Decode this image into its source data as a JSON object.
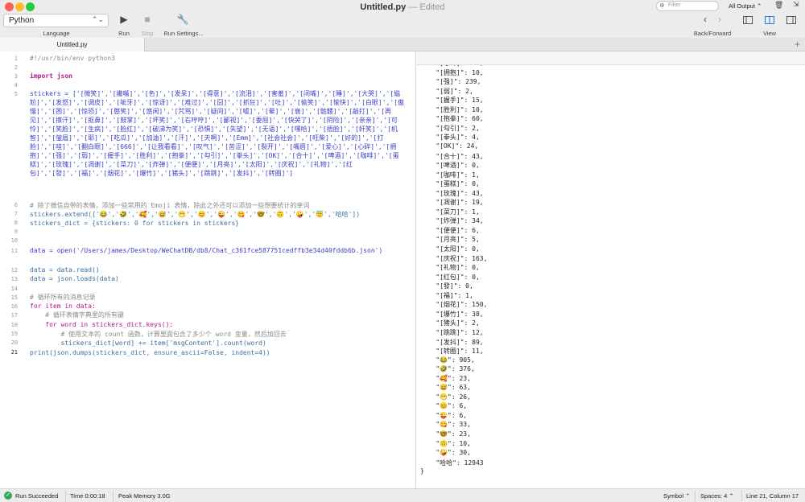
{
  "window": {
    "title": "Untitled.py",
    "edited": "— Edited",
    "colors": {
      "close": "#ff5f57",
      "minimize": "#febc2e",
      "zoom": "#28c840"
    }
  },
  "toolbar": {
    "language_value": "Python",
    "language_caption": "Language",
    "run_label": "Run",
    "stop_label": "Stop",
    "settings_label": "Run Settings...",
    "back_forward_label": "Back/Forward",
    "view_label": "View",
    "icons": {
      "run": "play-icon",
      "stop": "stop-icon",
      "settings": "wrench-icon",
      "back": "chevron-left-icon",
      "forward": "chevron-right-icon",
      "left_panel": "left-panel-icon",
      "split": "split-view-icon",
      "right_panel": "right-panel-icon"
    }
  },
  "tab": {
    "label": "Untitled.py",
    "add": "+"
  },
  "editor": {
    "line_numbers": [
      "1",
      "2",
      "3",
      "4",
      "5",
      "6",
      "7",
      "8",
      "9",
      "10",
      "11",
      "12",
      "13",
      "14",
      "15",
      "16",
      "17",
      "18",
      "19",
      "20",
      "21"
    ],
    "current_line": "21",
    "code": [
      "#!/usr/bin/env python3",
      "",
      "import json",
      "",
      "stickers = ['[微笑]','[撇嘴]','[色]','[发呆]','[得意]','[流泪]','[害羞]','[闭嘴]','[睡]','[大哭]','[尴尬]','[发怒]','[调皮]','[呲牙]','[惊讶]','[难过]','[囧]','[抓狂]','[吐]','[偷笑]','[愉快]','[白眼]','[傲慢]','[困]','[惊恐]','[憨笑]','[悠闲]','[咒骂]','[疑问]','[嘘]','[晕]','[衰]','[骷髅]','[敲打]','[再见]','[擦汗]','[抠鼻]','[鼓掌]','[坏笑]','[右哼哼]','[鄙视]','[委屈]','[快哭了]','[阴险]','[亲亲]','[可怜]','[笑脸]','[生病]','[脸红]','[破涕为笑]','[恐惧]','[失望]','[无语]','[嘿哈]','[捂脸]','[奸笑]','[机智]','[皱眉]','[耶]','[吃瓜]','[加油]','[汗]','[天啊]','[Emm]','[社会社会]','[旺柴]','[好的]','[打脸]','[哇]','[翻白眼]','[666]','[让我看看]','[叹气]','[苦涩]','[裂开]','[嘴唇]','[爱心]','[心碎]','[拥抱]','[强]','[弱]','[握手]','[胜利]','[抱拳]','[勾引]','[拳头]','[OK]','[合十]','[啤酒]','[咖啡]','[蛋糕]','[玫瑰]','[凋谢]','[菜刀]','[炸弹]','[便便]','[月亮]','[太阳]','[庆祝]','[礼物]','[红包]','[發]','[福]','[烟花]','[爆竹]','[猪头]','[跳跳]','[发抖]','[转圈]']",
      "# 除了微信自带的表情，添加一些常用的 Emoji 表情，除此之外还可以添加一些想要统计的单词",
      "stickers.extend(['😂','🤣','🥰','😅','😁','😊','😜','😋','🤓','🙃','🤪','😇','哈哈'])",
      "stickers_dict = {stickers: 0 for stickers in stickers}",
      "",
      "",
      "data = open('/Users/james/Desktop/WeChatDB/db8/Chat_c361fce587751cedffb3e34d40fddb6b.json')",
      "data = data.read()",
      "data = json.loads(data)",
      "",
      "# 循环所有的消息记录",
      "for item in data:",
      "    # 循环表情字典里的所有键",
      "    for word in stickers_dict.keys():",
      "        # 使用文本的 count 函数，计算里面包含了多少个 word 变量，然后加回去",
      "        stickers_dict[word] += item['msgContent'].count(word)",
      "print(json.dumps(stickers_dict, ensure_ascii=False, indent=4))"
    ]
  },
  "output": {
    "filter_placeholder": "Filter",
    "all_output_label": "All Output",
    "lines": [
      "    \"[心碎]\": 32,",
      "    \"[拥抱]\": 10,",
      "    \"[强]\": 239,",
      "    \"[弱]\": 2,",
      "    \"[握手]\": 15,",
      "    \"[胜利]\": 10,",
      "    \"[抱拳]\": 60,",
      "    \"[勾引]\": 2,",
      "    \"[拳头]\": 4,",
      "    \"[OK]\": 24,",
      "    \"[合十]\": 43,",
      "    \"[啤酒]\": 0,",
      "    \"[咖啡]\": 1,",
      "    \"[蛋糕]\": 0,",
      "    \"[玫瑰]\": 43,",
      "    \"[凋谢]\": 19,",
      "    \"[菜刀]\": 1,",
      "    \"[炸弹]\": 34,",
      "    \"[便便]\": 6,",
      "    \"[月亮]\": 5,",
      "    \"[太阳]\": 0,",
      "    \"[庆祝]\": 163,",
      "    \"[礼物]\": 0,",
      "    \"[红包]\": 0,",
      "    \"[發]\": 0,",
      "    \"[福]\": 1,",
      "    \"[烟花]\": 150,",
      "    \"[爆竹]\": 38,",
      "    \"[猪头]\": 2,",
      "    \"[跳跳]\": 12,",
      "    \"[发抖]\": 89,",
      "    \"[转圈]\": 11,",
      "    \"😂\": 905,",
      "    \"🤣\": 376,",
      "    \"🥰\": 23,",
      "    \"😅\": 63,",
      "    \"😁\": 26,",
      "    \"😊\": 6,",
      "    \"😜\": 6,",
      "    \"😋\": 33,",
      "    \"🤓\": 23,",
      "    \"🙃\": 10,",
      "    \"🤪\": 30,",
      "    \"哈哈\": 12943",
      "}"
    ]
  },
  "status": {
    "result": "Run Succeeded",
    "time": "Time 0:00:18",
    "memory": "Peak Memory 3.0G",
    "symbol": "Symbol",
    "spaces": "Spaces: 4",
    "position": "Line 21, Column 17",
    "ok_icon": "checkmark-icon"
  }
}
